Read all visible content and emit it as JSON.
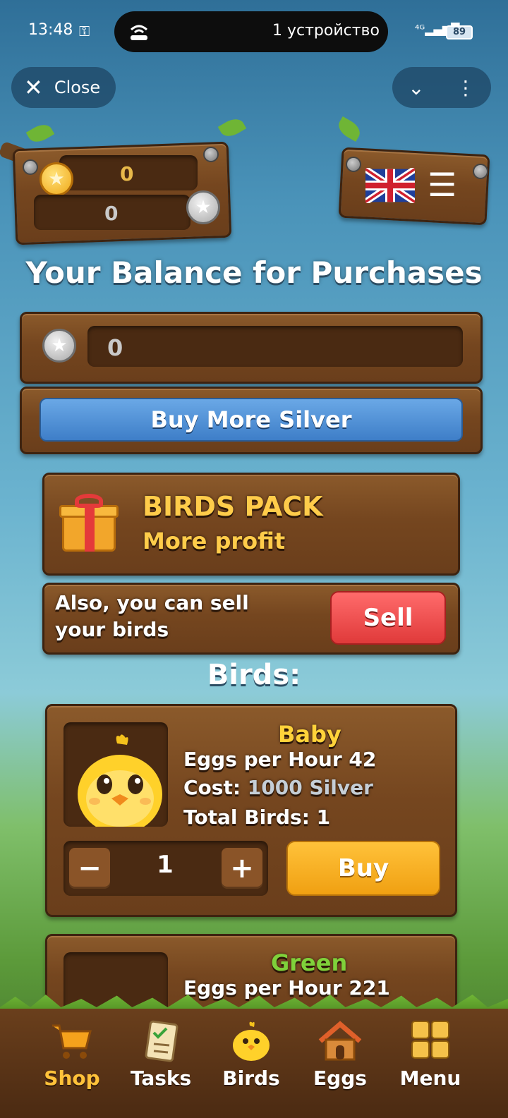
{
  "status_bar": {
    "time": "13:48",
    "key_glyph": "⚿",
    "pill_text": "1 устройство",
    "signal": "⁴ᴳ▂▄▆█",
    "battery": "89"
  },
  "top_bar": {
    "close_label": "Close",
    "close_glyph": "✕",
    "chevron_glyph": "⌄",
    "more_glyph": "⋮"
  },
  "header": {
    "gold_balance": "0",
    "silver_balance": "0",
    "star_glyph": "★",
    "menu_glyph": "☰"
  },
  "balance": {
    "title": "Your Balance for Purchases",
    "silver_value": "0",
    "buy_more_label": "Buy More Silver"
  },
  "pack": {
    "title": "BIRDS PACK",
    "subtitle": "More profit"
  },
  "sell": {
    "text": "Also, you can sell your birds",
    "button_label": "Sell"
  },
  "birds": {
    "title": "Birds:",
    "items": [
      {
        "name": "Baby",
        "eggs_line": "Eggs per Hour 42",
        "cost_label": "Cost:",
        "cost_value": "1000 Silver",
        "total_line": "Total Birds: 1",
        "quantity": "1",
        "minus_glyph": "−",
        "plus_glyph": "+",
        "buy_label": "Buy"
      },
      {
        "name": "Green",
        "eggs_line": "Eggs per Hour 221"
      }
    ]
  },
  "nav": {
    "items": [
      {
        "label": "Shop",
        "icon": "shop-cart-icon",
        "active": true
      },
      {
        "label": "Tasks",
        "icon": "tasks-icon"
      },
      {
        "label": "Birds",
        "icon": "bird-icon"
      },
      {
        "label": "Eggs",
        "icon": "house-icon"
      },
      {
        "label": "Menu",
        "icon": "grid-icon"
      }
    ]
  },
  "colors": {
    "wood": "#75461f",
    "gold_text": "#ffcc4a",
    "blue_button": "#4a8fd8",
    "red_button": "#e84444",
    "yellow_button": "#f5a91c",
    "green_name": "#7fd13a"
  }
}
